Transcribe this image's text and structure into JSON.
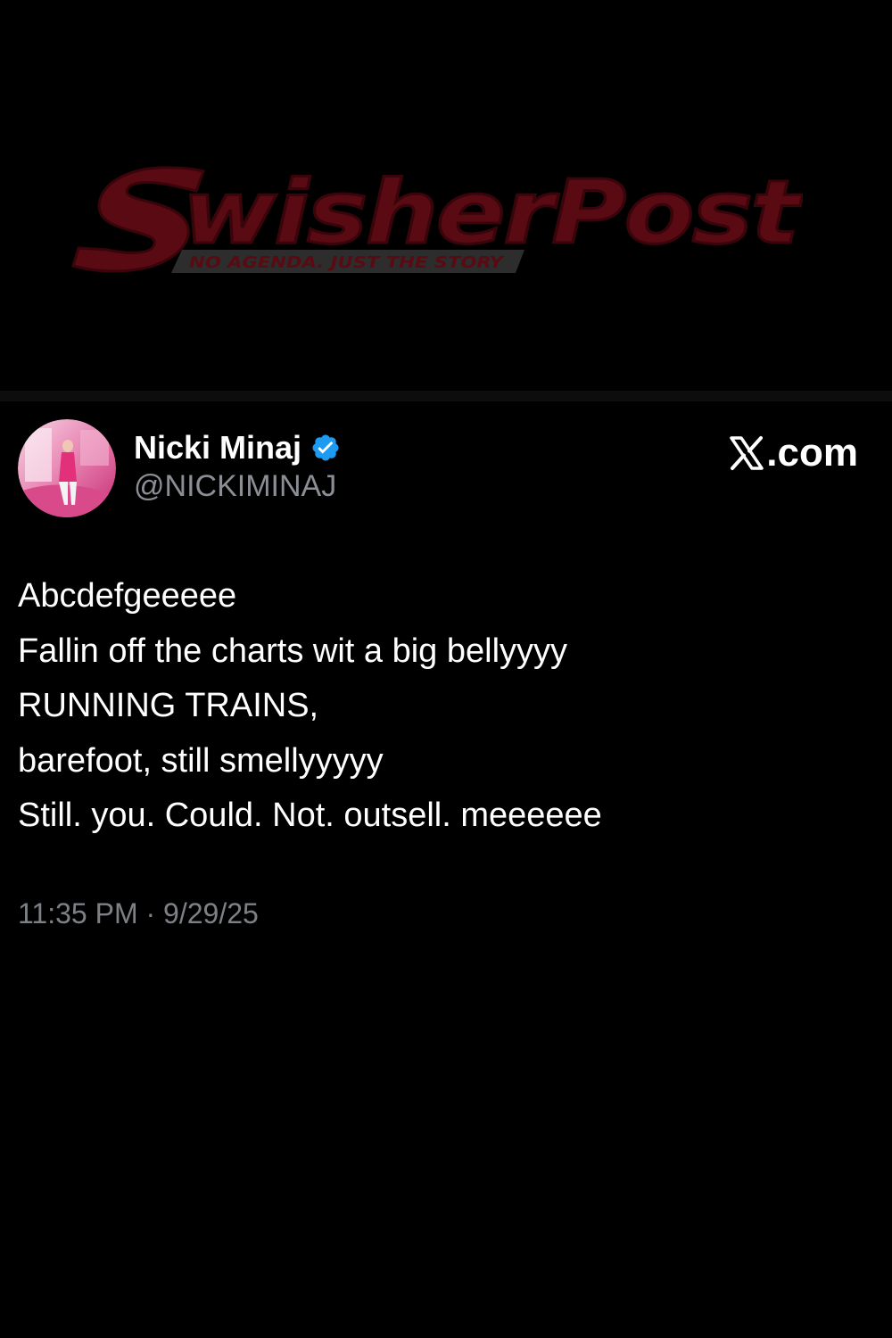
{
  "watermark": {
    "brand": "SwisherPost",
    "tagline": "NO AGENDA. JUST THE STORY"
  },
  "tweet": {
    "author": {
      "display_name": "Nicki Minaj",
      "handle": "@NICKIMINAJ",
      "verified": true,
      "verified_icon": "verified-badge-icon",
      "avatar_icon": "profile-avatar"
    },
    "site_badge": {
      "icon": "x-logo-icon",
      "text": ".com"
    },
    "lines": [
      "Abcdefgeeeee",
      "Fallin off the charts wit a big bellyyyy",
      "RUNNING TRAINS,",
      "barefoot, still smellyyyyy",
      "Still. you. Could. Not. outsell. meeeeee"
    ],
    "timestamp": "11:35 PM · 9/29/25"
  },
  "colors": {
    "background": "#000000",
    "text": "#ffffff",
    "secondary_text": "#8b8f95",
    "verified_blue": "#1d9bf0",
    "watermark_red": "#5a0a12"
  }
}
